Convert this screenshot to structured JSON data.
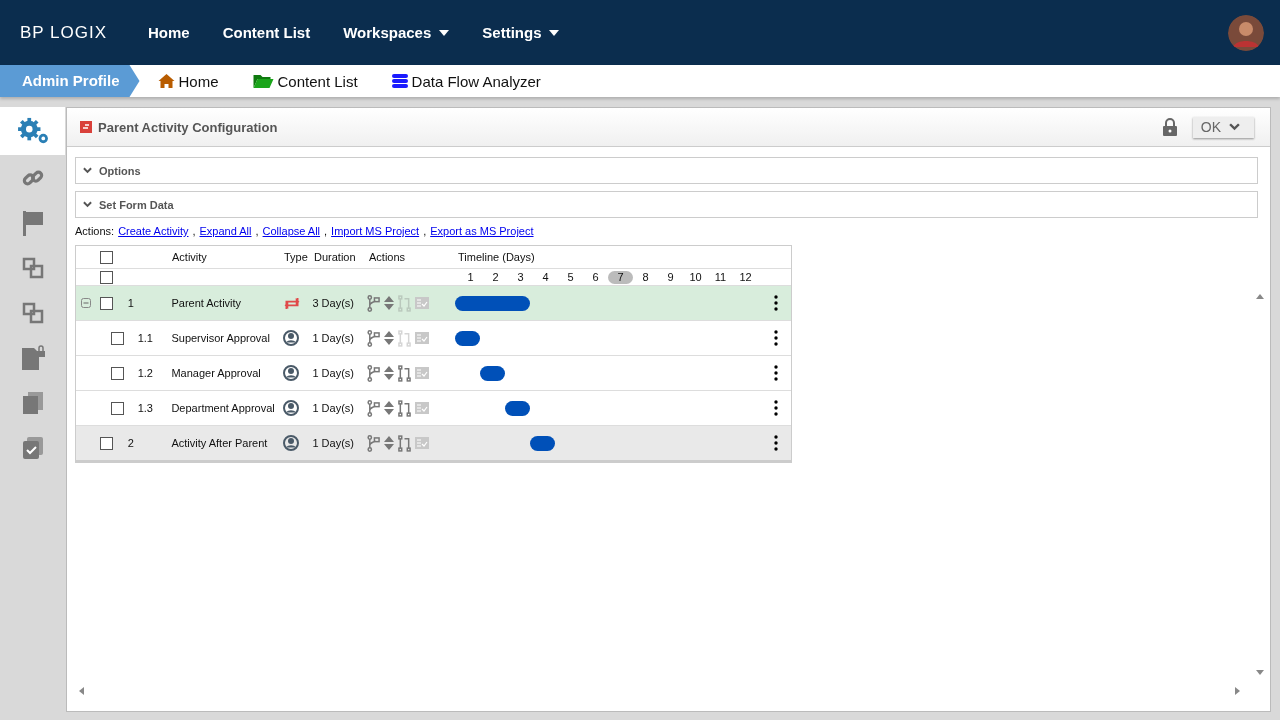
{
  "top_nav": {
    "brand": "BP LOGIX",
    "items": [
      {
        "label": "Home",
        "has_menu": false
      },
      {
        "label": "Content List",
        "has_menu": false
      },
      {
        "label": "Workspaces",
        "has_menu": true
      },
      {
        "label": "Settings",
        "has_menu": true
      }
    ]
  },
  "breadcrumb": {
    "current": "Admin Profile",
    "links": [
      {
        "label": "Home",
        "kind": "home"
      },
      {
        "label": "Content List",
        "kind": "folder"
      },
      {
        "label": "Data Flow Analyzer",
        "kind": "database"
      }
    ]
  },
  "sidebar": {
    "items": [
      {
        "kind": "settings",
        "selected": true
      },
      {
        "kind": "link",
        "selected": false
      },
      {
        "kind": "flag",
        "selected": false
      },
      {
        "kind": "copy",
        "selected": false
      },
      {
        "kind": "copy",
        "selected": false
      },
      {
        "kind": "file-lock",
        "selected": false
      },
      {
        "kind": "documents",
        "selected": false
      },
      {
        "kind": "checklist",
        "selected": false
      }
    ]
  },
  "panel": {
    "title": "Parent Activity Configuration",
    "ok_button": "OK",
    "locked": true,
    "sections": [
      {
        "label": "Options",
        "expanded": true
      },
      {
        "label": "Set Form Data",
        "expanded": true
      }
    ],
    "actions_label": "Actions:",
    "actions": [
      {
        "kind": "link",
        "text": "Create Activity"
      },
      {
        "kind": "separator",
        "text": ","
      },
      {
        "kind": "link",
        "text": "Expand All"
      },
      {
        "kind": "separator",
        "text": ","
      },
      {
        "kind": "link",
        "text": "Collapse All"
      },
      {
        "kind": "separator",
        "text": ","
      },
      {
        "kind": "link",
        "text": "Import MS Project"
      },
      {
        "kind": "separator",
        "text": ","
      },
      {
        "kind": "link",
        "text": "Export as MS Project"
      }
    ],
    "table": {
      "header_checked": false,
      "day_row_checked": false,
      "columns": [
        "Activity",
        "Type",
        "Duration",
        "Actions",
        "Timeline (Days)"
      ],
      "days": [
        {
          "label": "1",
          "selected": false
        },
        {
          "label": "2",
          "selected": false
        },
        {
          "label": "3",
          "selected": false
        },
        {
          "label": "4",
          "selected": false
        },
        {
          "label": "5",
          "selected": false
        },
        {
          "label": "6",
          "selected": false
        },
        {
          "label": "7",
          "selected": true
        },
        {
          "label": "8",
          "selected": false
        },
        {
          "label": "9",
          "selected": false
        },
        {
          "label": "10",
          "selected": false
        },
        {
          "label": "11",
          "selected": false
        },
        {
          "label": "12",
          "selected": false
        }
      ],
      "rows": [
        {
          "number": "1",
          "activity": "Parent Activity",
          "kind": "loop",
          "duration": "3 Day(s)",
          "timeline": [
            true,
            true,
            true,
            false,
            false,
            false,
            false,
            false,
            false,
            false,
            false,
            false
          ],
          "checked": false,
          "selected": true,
          "shaded": false,
          "expanded": true,
          "link_enabled": false,
          "children": [
            {
              "number": "1.1",
              "activity": "Supervisor Approval",
              "kind": "user",
              "duration": "1 Day(s)",
              "timeline": [
                true,
                false,
                false,
                false,
                false,
                false,
                false,
                false,
                false,
                false,
                false,
                false
              ],
              "checked": false,
              "selected": false,
              "shaded": false,
              "link_enabled": false
            },
            {
              "number": "1.2",
              "activity": "Manager Approval",
              "kind": "user",
              "duration": "1 Day(s)",
              "timeline": [
                false,
                true,
                false,
                false,
                false,
                false,
                false,
                false,
                false,
                false,
                false,
                false
              ],
              "checked": false,
              "selected": false,
              "shaded": false,
              "link_enabled": true
            },
            {
              "number": "1.3",
              "activity": "Department Approval",
              "kind": "user",
              "duration": "1 Day(s)",
              "timeline": [
                false,
                false,
                true,
                false,
                false,
                false,
                false,
                false,
                false,
                false,
                false,
                false
              ],
              "checked": false,
              "selected": false,
              "shaded": false,
              "link_enabled": true
            }
          ]
        },
        {
          "number": "2",
          "activity": "Activity After Parent",
          "kind": "user",
          "duration": "1 Day(s)",
          "timeline": [
            false,
            false,
            false,
            true,
            false,
            false,
            false,
            false,
            false,
            false,
            false,
            false
          ],
          "checked": false,
          "selected": false,
          "shaded": true,
          "link_enabled": true
        }
      ]
    }
  }
}
